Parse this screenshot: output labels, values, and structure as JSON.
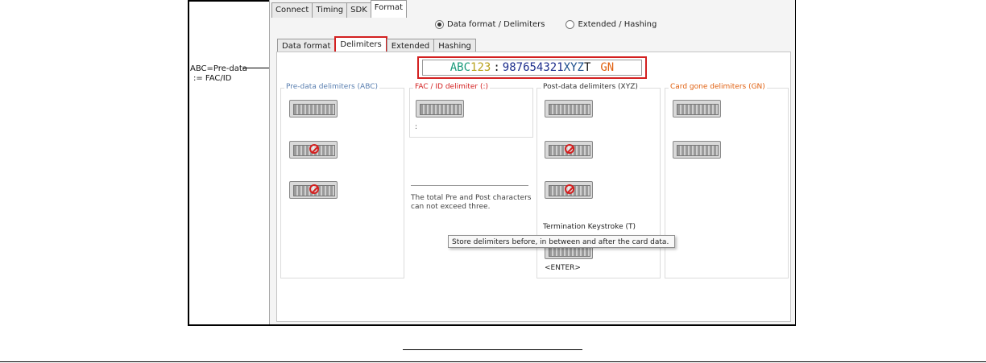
{
  "callout": {
    "line1": "ABC=Pre-data",
    "line2": ":= FAC/ID"
  },
  "top_tabs": [
    "Connect",
    "Timing",
    "SDK",
    "Format"
  ],
  "radios": {
    "option1": "Data format / Delimiters",
    "option2": "Extended / Hashing"
  },
  "sub_tabs": [
    "Data format",
    "Delimiters",
    "Extended",
    "Hashing"
  ],
  "sample": {
    "pre": "ABC",
    "fac": "123",
    "sep": ":",
    "id": "987654321",
    "post": "XYZ",
    "term": "T",
    "gone": "GN",
    "colors": {
      "pre": "#1a9a7a",
      "fac": "#b8a11c",
      "sep": "#111111",
      "id": "#1c2d8c",
      "post": "#1c4f8c",
      "term": "#111111",
      "gone": "#e06010"
    }
  },
  "groups": {
    "pre": {
      "title": "Pre-data delimiters (ABC)",
      "color": "#5a7fb0"
    },
    "fac": {
      "title": "FAC / ID delimiter (:)",
      "color": "#d32020",
      "value": ":"
    },
    "post": {
      "title": "Post-data delimiters (XYZ)",
      "color": "#333333"
    },
    "gone": {
      "title": "Card gone delimiters (GN)",
      "color": "#e06010"
    }
  },
  "note": {
    "line1": "The total Pre and Post characters",
    "line2": "can not exceed three."
  },
  "termination": {
    "label": "Termination Keystroke (T)",
    "value": "<ENTER>"
  },
  "tooltip": "Store delimiters before, in between and after the card data."
}
